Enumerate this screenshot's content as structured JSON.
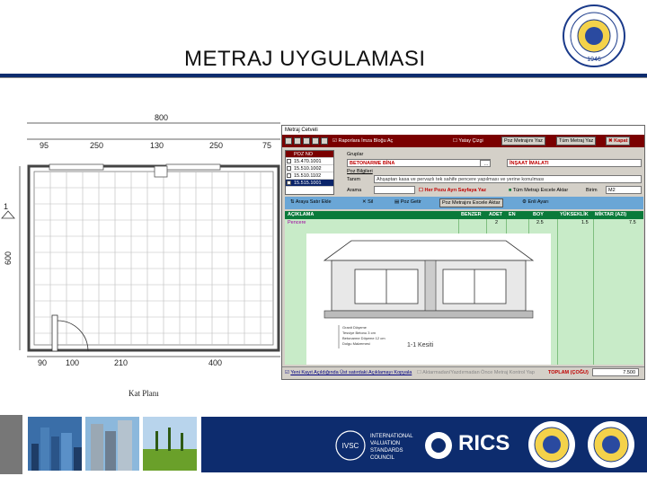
{
  "header": {
    "title": "METRAJ  UYGULAMASI",
    "logo_top_text": "ANKARA ÜNİVERSİTESİ",
    "logo_year": "1946"
  },
  "plan": {
    "dim_total_top": "800",
    "dims_top": [
      "95",
      "250",
      "130",
      "250",
      "75"
    ],
    "dims_bottom": [
      "90",
      "100",
      "210",
      "400"
    ],
    "dim_side": "600",
    "section_marker": "1",
    "caption": "Kat Planı"
  },
  "app": {
    "window_title": "Metraj Cetveli",
    "toolbar": {
      "checkbox_label": "Raporlara İmza Bloğu Aç",
      "yatay_cizgi": "Yatay Çizgi",
      "poz_metrajini_yaz": "Poz Metrajını Yaz",
      "tum_metraji_yaz": "Tüm Metraj Yaz",
      "kapat": "Kapat"
    },
    "poz_list": {
      "header": "POZ NO",
      "items": [
        "15.470.1001",
        "15.510.1002",
        "15.510.1102",
        "15.515.1001"
      ]
    },
    "fields": {
      "gruplar_label": "Gruplar",
      "gruplar_value": "BETONARME BİNA",
      "insaat_value": "İNŞAAT İMALATI",
      "poz_bilgileri_label": "Poz Bilgileri",
      "tanim_label": "Tanım",
      "tanim_value": "Ahşaptan kasa ve pervazlı tek sahife pencere yapılması ve yerine konulması",
      "arama_label": "Arama",
      "her_pozu_label": "Her Pozu Ayrı Sayfaya Yaz",
      "tum_metraj_excel": "Tüm Metrajı Excele Aktar",
      "birim_label": "Birim",
      "birim_value": "M2"
    },
    "blue_bar": {
      "araya_satir_ekle": "Araya Satır Ekle",
      "sil": "Sil",
      "poz_getir": "Poz Getir",
      "poz_metrajini_excel": "Poz Metrajını Excele Aktar",
      "enli_ayarı": "Enli Ayarı"
    },
    "grid": {
      "headers": [
        "AÇIKLAMA",
        "BENZER",
        "ADET",
        "EN",
        "BOY",
        "YÜKSEKLİK",
        "MİKTAR (AZI)"
      ],
      "rows": [
        {
          "aciklama": "Pencere",
          "benzer": "",
          "adet": "2",
          "en": "",
          "boy": "2.5",
          "yukseklik": "1.5",
          "miktar": "7.5"
        }
      ]
    },
    "section": {
      "caption": "1-1 Kesiti",
      "legend": [
        "Granit Döşeme",
        "Tesviye Betonu 3 cm",
        "Betonarme Döşeme 12 cm",
        "Dolgu Malzemesi"
      ]
    },
    "footer": {
      "yeni_kayit": "Yeni Kayıt Açıldığında Üst satırdaki Açıklamayı Kopyala",
      "aktarmadan": "Aktarmadan/Yazdırmadan Önce Metraj Kontrol Yap",
      "toplam_label": "TOPLAM (ÇOĞU)",
      "toplam_value": "7.500"
    }
  },
  "banner": {
    "ivsc_lines": [
      "INTERNATIONAL",
      "VALUATION",
      "STANDARDS",
      "COUNCIL"
    ],
    "ivsc_mark": "IVSC",
    "rics": "RICS"
  }
}
